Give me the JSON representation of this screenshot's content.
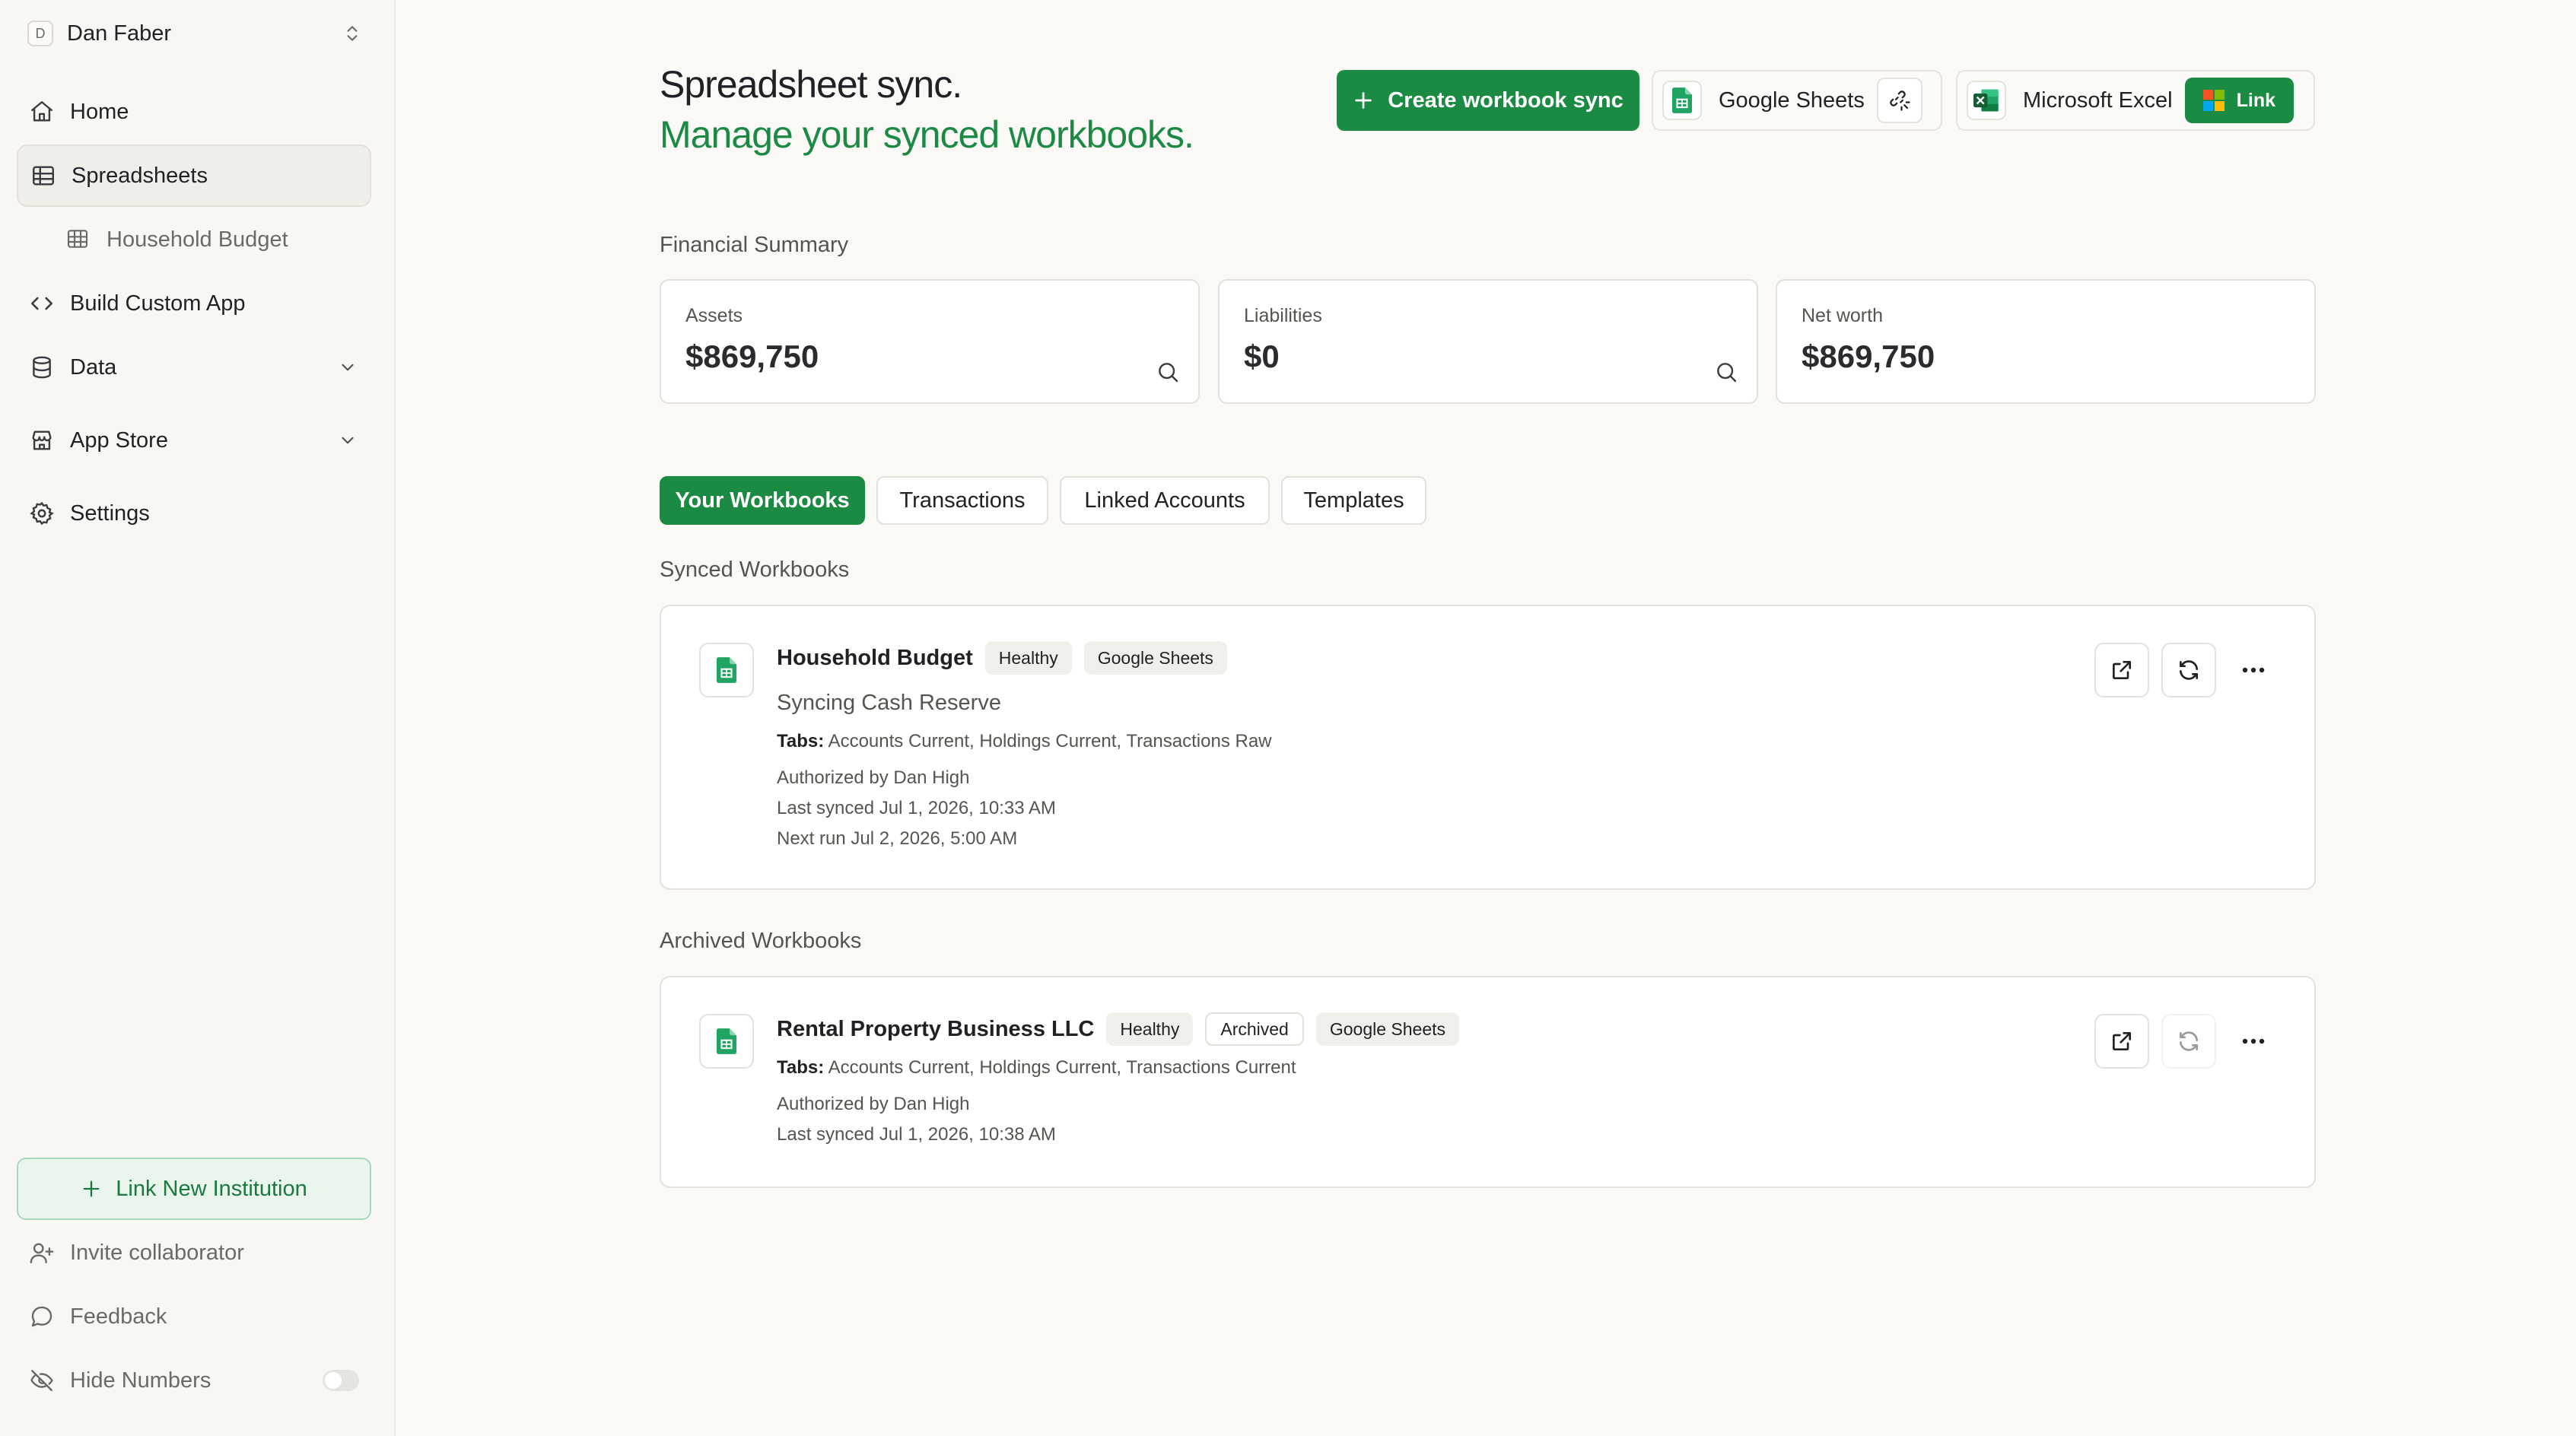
{
  "user": {
    "initial": "D",
    "name": "Dan Faber"
  },
  "sidebar": {
    "items": [
      {
        "label": "Home"
      },
      {
        "label": "Spreadsheets"
      },
      {
        "label": "Household Budget"
      },
      {
        "label": "Build Custom App"
      },
      {
        "label": "Data"
      },
      {
        "label": "App Store"
      },
      {
        "label": "Settings"
      }
    ],
    "link_institution": "Link New Institution",
    "invite": "Invite collaborator",
    "feedback": "Feedback",
    "hide_numbers": "Hide Numbers"
  },
  "header": {
    "title": "Spreadsheet sync.",
    "subtitle": "Manage your synced workbooks.",
    "create_button": "Create workbook sync",
    "google": {
      "label": "Google Sheets"
    },
    "excel": {
      "label": "Microsoft Excel",
      "link_button": "Link"
    }
  },
  "summary": {
    "heading": "Financial Summary",
    "cards": [
      {
        "label": "Assets",
        "value": "$869,750"
      },
      {
        "label": "Liabilities",
        "value": "$0"
      },
      {
        "label": "Net worth",
        "value": "$869,750"
      }
    ]
  },
  "tabs": [
    "Your Workbooks",
    "Transactions",
    "Linked Accounts",
    "Templates"
  ],
  "synced": {
    "heading": "Synced Workbooks",
    "workbooks": [
      {
        "name": "Household Budget",
        "status": "Healthy",
        "provider": "Google Sheets",
        "sync_status": "Syncing Cash Reserve",
        "tabs_label": "Tabs:",
        "tabs": "Accounts Current, Holdings Current, Transactions Raw",
        "authorized": "Authorized by Dan High",
        "last_synced": "Last synced Jul 1, 2026, 10:33 AM",
        "next_run": "Next run Jul 2, 2026, 5:00 AM"
      }
    ]
  },
  "archived": {
    "heading": "Archived Workbooks",
    "workbooks": [
      {
        "name": "Rental Property Business LLC",
        "status": "Healthy",
        "archived_badge": "Archived",
        "provider": "Google Sheets",
        "tabs_label": "Tabs:",
        "tabs": "Accounts Current, Holdings Current, Transactions Current",
        "authorized": "Authorized by Dan High",
        "last_synced": "Last synced Jul 1, 2026, 10:38 AM"
      }
    ]
  },
  "colors": {
    "accent": "#1b8a42",
    "accent_text": "#1c8a45",
    "background": "#faf9f5",
    "border": "#e3e1da"
  },
  "icons": {
    "home": "home-icon",
    "spreadsheets": "table-icon",
    "code": "code-icon",
    "data": "database-icon",
    "store": "store-icon",
    "settings": "gear-icon",
    "invite": "user-plus-icon",
    "feedback": "chat-bubble-icon",
    "hide": "eye-off-icon"
  }
}
